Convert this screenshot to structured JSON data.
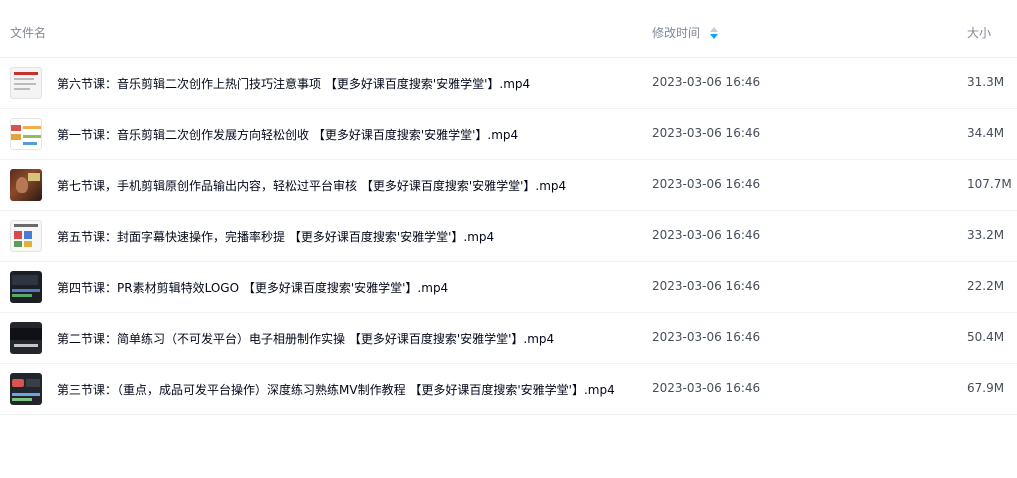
{
  "header": {
    "name_label": "文件名",
    "time_label": "修改时间",
    "size_label": "大小"
  },
  "files": [
    {
      "name": "第六节课：音乐剪辑二次创作上热门技巧注意事项 【更多好课百度搜索'安雅学堂'】.mp4",
      "time": "2023-03-06 16:46",
      "size": "31.3M",
      "thumb": "document-thumbnail"
    },
    {
      "name": "第一节课：音乐剪辑二次创作发展方向轻松创收 【更多好课百度搜索'安雅学堂'】.mp4",
      "time": "2023-03-06 16:46",
      "size": "34.4M",
      "thumb": "slides-thumbnail"
    },
    {
      "name": "第七节课，手机剪辑原创作品输出内容，轻松过平台审核 【更多好课百度搜索'安雅学堂'】.mp4",
      "time": "2023-03-06 16:46",
      "size": "107.7M",
      "thumb": "photo-thumbnail"
    },
    {
      "name": "第五节课：封面字幕快速操作，完播率秒提 【更多好课百度搜索'安雅学堂'】.mp4",
      "time": "2023-03-06 16:46",
      "size": "33.2M",
      "thumb": "ui-thumbnail"
    },
    {
      "name": "第四节课：PR素材剪辑特效LOGO 【更多好课百度搜索'安雅学堂'】.mp4",
      "time": "2023-03-06 16:46",
      "size": "22.2M",
      "thumb": "dark-ui-thumbnail"
    },
    {
      "name": "第二节课：简单练习（不可发平台）电子相册制作实操 【更多好课百度搜索'安雅学堂'】.mp4",
      "time": "2023-03-06 16:46",
      "size": "50.4M",
      "thumb": "dark-video-thumbnail"
    },
    {
      "name": "第三节课：（重点，成品可发平台操作）深度练习熟练MV制作教程 【更多好课百度搜索'安雅学堂'】.mp4",
      "time": "2023-03-06 16:46",
      "size": "67.9M",
      "thumb": "editor-thumbnail"
    }
  ],
  "colors": {
    "header_text": "#818999",
    "name_text": "#03081a",
    "meta_text": "#454d5a",
    "sort_active": "#06a7ff",
    "divider": "#f1f2f4"
  }
}
